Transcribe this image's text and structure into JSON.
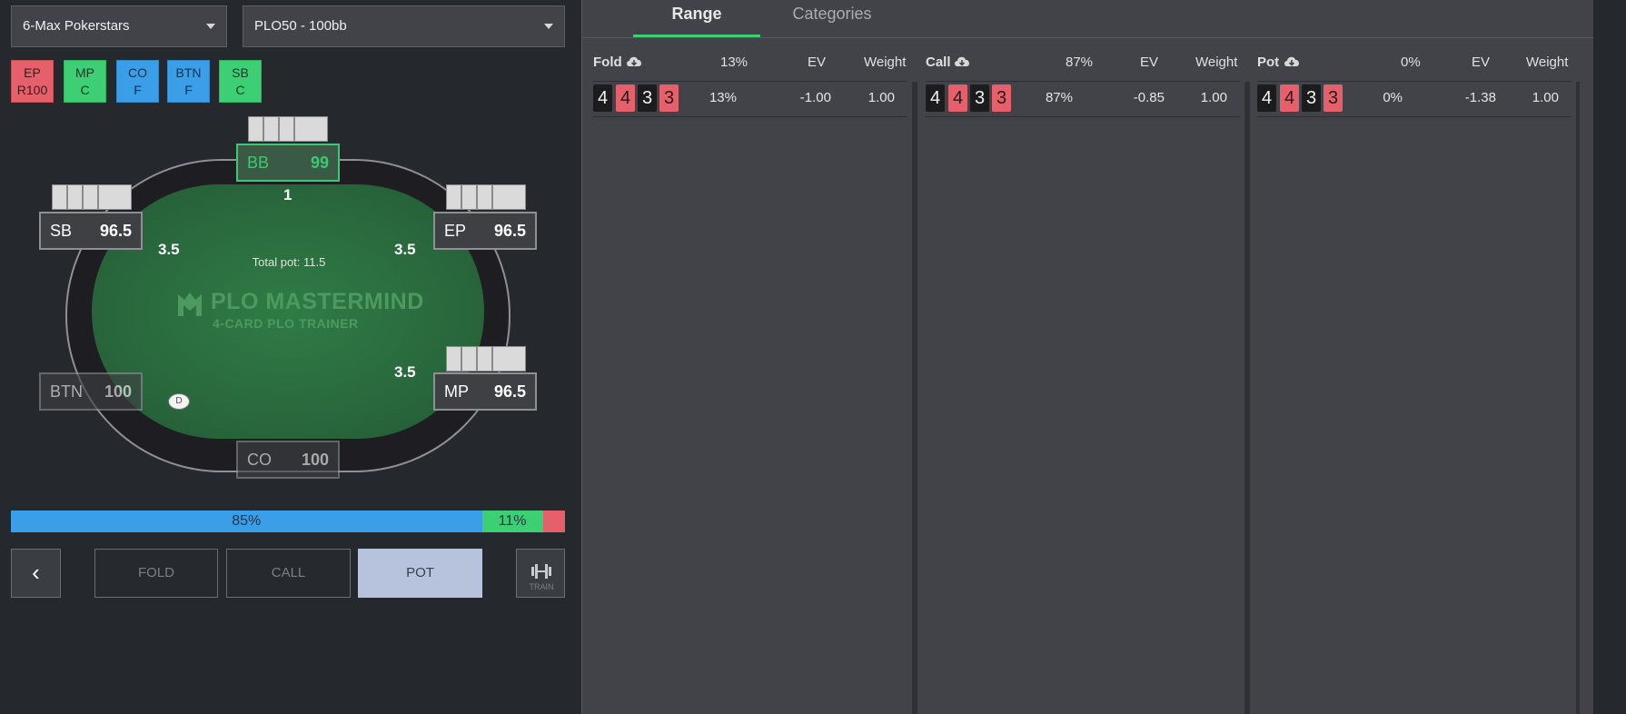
{
  "selectors": {
    "site": "6-Max Pokerstars",
    "stakes": "PLO50 - 100bb"
  },
  "action_history": [
    {
      "pos": "EP",
      "action": "R100",
      "color": "#e5606a"
    },
    {
      "pos": "MP",
      "action": "C",
      "color": "#3ccf73"
    },
    {
      "pos": "CO",
      "action": "F",
      "color": "#3b9ee8"
    },
    {
      "pos": "BTN",
      "action": "F",
      "color": "#3b9ee8"
    },
    {
      "pos": "SB",
      "action": "C",
      "color": "#3ccf73"
    }
  ],
  "table": {
    "seats": {
      "bb": {
        "pos": "BB",
        "stack": "99"
      },
      "sb": {
        "pos": "SB",
        "stack": "96.5"
      },
      "ep": {
        "pos": "EP",
        "stack": "96.5"
      },
      "btn": {
        "pos": "BTN",
        "stack": "100"
      },
      "mp": {
        "pos": "MP",
        "stack": "96.5"
      },
      "co": {
        "pos": "CO",
        "stack": "100"
      }
    },
    "bets": {
      "bb": "1",
      "sb": "3.5",
      "ep": "3.5",
      "mp": "3.5"
    },
    "total_pot": "Total pot: 11.5",
    "logo_title": "PLO MASTERMIND",
    "logo_subtitle": "4-CARD PLO TRAINER",
    "dealer": "D"
  },
  "frequency_bar": {
    "call_pct": 85,
    "call_label": "85%",
    "pot_pct": 11,
    "pot_label": "11%",
    "fold_pct": 4,
    "colors": {
      "call": "#3b9ee8",
      "pot": "#3ccf73",
      "fold": "#e5606a"
    }
  },
  "controls": {
    "back": "‹",
    "fold": "FOLD",
    "call": "CALL",
    "pot": "POT",
    "train": "TRAIN"
  },
  "tabs": {
    "range": "Range",
    "categories": "Categories"
  },
  "columns": [
    {
      "name": "Fold",
      "pct": "13%",
      "ev_label": "EV",
      "weight_label": "Weight",
      "hand": [
        "4",
        "4",
        "3",
        "3"
      ],
      "hand_colors": [
        "black",
        "red",
        "black",
        "red"
      ],
      "row_pct": "13%",
      "row_ev": "-1.00",
      "row_weight": "1.00"
    },
    {
      "name": "Call",
      "pct": "87%",
      "ev_label": "EV",
      "weight_label": "Weight",
      "hand": [
        "4",
        "4",
        "3",
        "3"
      ],
      "hand_colors": [
        "black",
        "red",
        "black",
        "red"
      ],
      "row_pct": "87%",
      "row_ev": "-0.85",
      "row_weight": "1.00"
    },
    {
      "name": "Pot",
      "pct": "0%",
      "ev_label": "EV",
      "weight_label": "Weight",
      "hand": [
        "4",
        "4",
        "3",
        "3"
      ],
      "hand_colors": [
        "black",
        "red",
        "black",
        "red"
      ],
      "row_pct": "0%",
      "row_ev": "-1.38",
      "row_weight": "1.00"
    }
  ],
  "icons": {
    "download": "cloud-download-icon",
    "caret": "chevron-down-icon",
    "train": "dumbbell-icon"
  }
}
